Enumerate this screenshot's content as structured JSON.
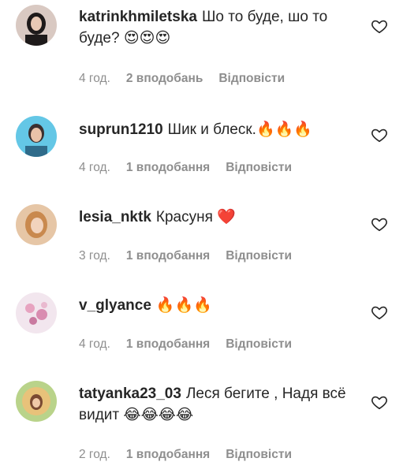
{
  "comments": [
    {
      "username": "katrinkhmiletska",
      "text": "Шо то буде, шо то буде?",
      "emoji": "😍😍😍",
      "time": "4 год.",
      "likes": "2 вподобань",
      "reply": "Відповісти"
    },
    {
      "username": "suprun1210",
      "text": "Шик и блеск.",
      "emoji": "🔥🔥🔥",
      "time": "4 год.",
      "likes": "1 вподобання",
      "reply": "Відповісти"
    },
    {
      "username": "lesia_nktk",
      "text": "Красуня",
      "emoji": "❤️",
      "time": "3 год.",
      "likes": "1 вподобання",
      "reply": "Відповісти"
    },
    {
      "username": "v_glyance",
      "text": "",
      "emoji": "🔥🔥🔥",
      "time": "4 год.",
      "likes": "1 вподобання",
      "reply": "Відповісти"
    },
    {
      "username": "tatyanka23_03",
      "text": "Леся бегите , Надя всё видит",
      "emoji": "😂😂😂😂",
      "time": "2 год.",
      "likes": "1 вподобання",
      "reply": "Відповісти"
    }
  ],
  "icons": {
    "like": "heart-outline-icon"
  },
  "colors": {
    "text": "#262626",
    "meta": "#8e8e8e"
  }
}
